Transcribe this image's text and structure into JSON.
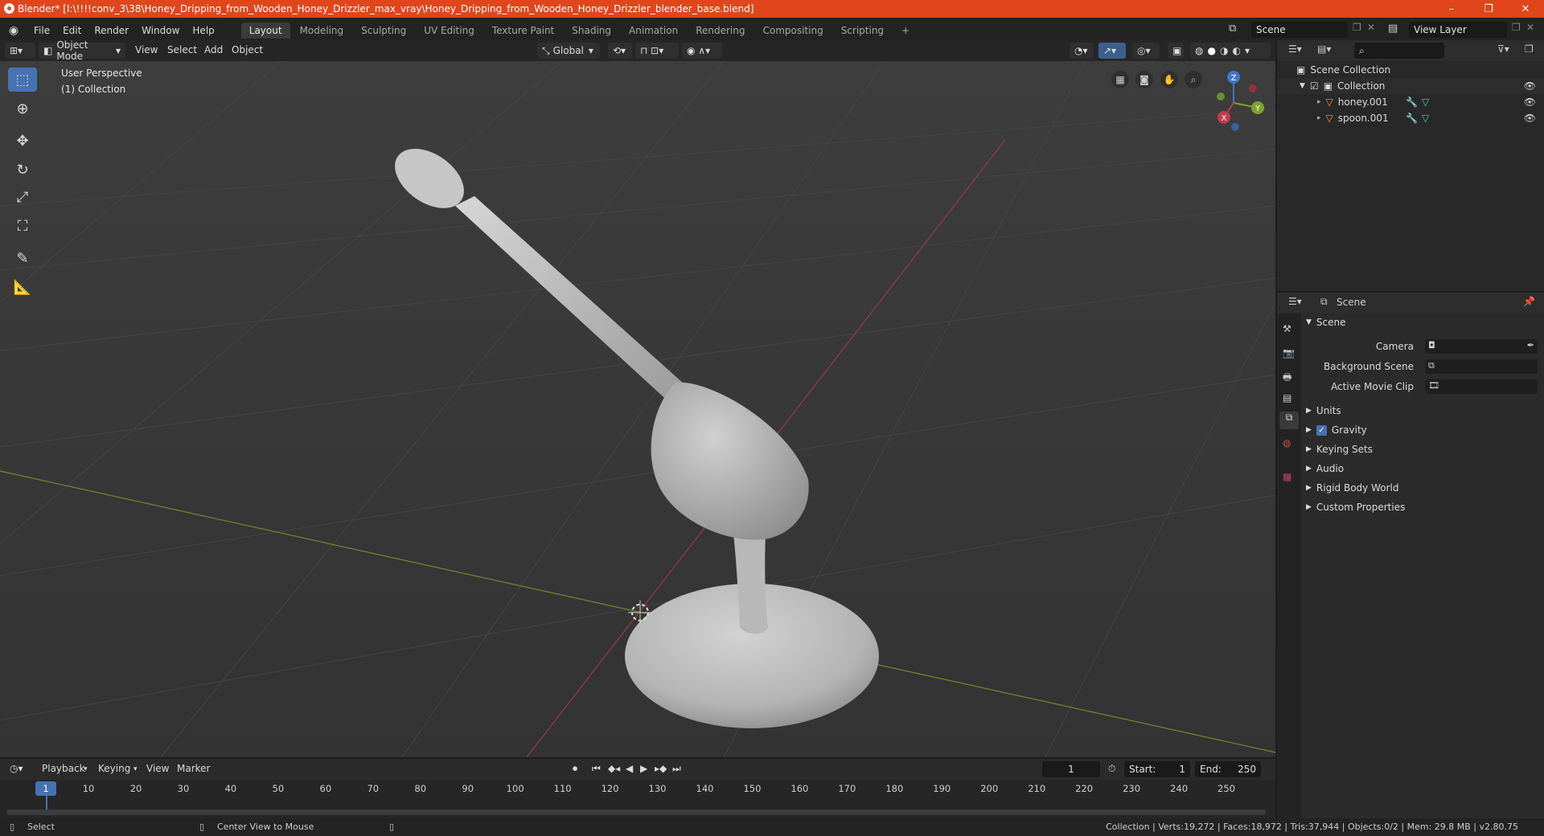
{
  "window": {
    "title": "Blender* [I:\\!!!!conv_3\\38\\Honey_Dripping_from_Wooden_Honey_Drizzler_max_vray\\Honey_Dripping_from_Wooden_Honey_Drizzler_blender_base.blend]",
    "minimize": "–",
    "maximize": "❐",
    "close": "✕"
  },
  "menu": [
    "File",
    "Edit",
    "Render",
    "Window",
    "Help"
  ],
  "workspaces": [
    "Layout",
    "Modeling",
    "Sculpting",
    "UV Editing",
    "Texture Paint",
    "Shading",
    "Animation",
    "Rendering",
    "Compositing",
    "Scripting"
  ],
  "active_workspace": "Layout",
  "add_workspace": "+",
  "scene_field": "Scene",
  "view_layer_field": "View Layer",
  "viewport_header": {
    "mode": "Object Mode",
    "menus": [
      "View",
      "Select",
      "Add",
      "Object"
    ],
    "orientation": "Global"
  },
  "viewport": {
    "perspective": "User Perspective",
    "collection": "(1) Collection",
    "gizmo": {
      "z": "Z",
      "y": "Y",
      "x": "X"
    }
  },
  "outliner": {
    "search_placeholder": "",
    "scene_collection": "Scene Collection",
    "collection": "Collection",
    "objects": [
      "honey.001",
      "spoon.001"
    ]
  },
  "properties": {
    "header": "Scene",
    "panel": "Scene",
    "camera_label": "Camera",
    "background_scene_label": "Background Scene",
    "active_movie_clip_label": "Active Movie Clip",
    "sections": [
      "Units",
      "Gravity",
      "Keying Sets",
      "Audio",
      "Rigid Body World",
      "Custom Properties"
    ],
    "gravity_checked": true
  },
  "timeline": {
    "menus": [
      "Playback",
      "Keying",
      "View",
      "Marker"
    ],
    "current_frame": "1",
    "start_label": "Start:",
    "start": "1",
    "end_label": "End:",
    "end": "250",
    "ticks": [
      "1",
      "10",
      "20",
      "30",
      "40",
      "50",
      "60",
      "70",
      "80",
      "90",
      "100",
      "110",
      "120",
      "130",
      "140",
      "150",
      "160",
      "170",
      "180",
      "190",
      "200",
      "210",
      "220",
      "230",
      "240",
      "250"
    ]
  },
  "statusbar": {
    "select": "Select",
    "center_view": "Center View to Mouse",
    "stats": "Collection | Verts:19,272 | Faces:18,972 | Tris:37,944 | Objects:0/2 | Mem: 29.8 MB | v2.80.75"
  },
  "colors": {
    "accent": "#4772b3",
    "titlebar": "#e0461c",
    "x_axis": "#c33a4b",
    "y_axis": "#7ca32c",
    "z_axis": "#3f78c9"
  }
}
